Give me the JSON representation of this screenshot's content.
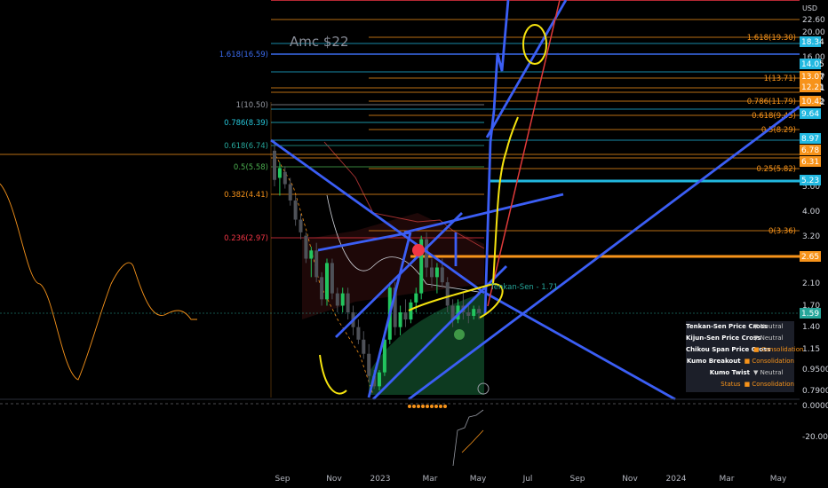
{
  "axis": {
    "currency": "USD",
    "y_ticks": [
      "22.60",
      "20.00",
      "16.00",
      "13.07",
      "12.21",
      "10.42",
      "8.97",
      "6.78",
      "6.31",
      "5.00",
      "4.00",
      "3.20",
      "2.10",
      "1.70",
      "1.40",
      "1.15",
      "0.9500",
      "0.7900"
    ],
    "x_ticks": [
      "Sep",
      "Nov",
      "2023",
      "Mar",
      "May",
      "Jul",
      "Sep",
      "Nov",
      "2024",
      "Mar",
      "May"
    ],
    "osc_ticks": [
      "0.0000",
      "-20.00"
    ]
  },
  "annotation": {
    "text": "Amc $22"
  },
  "price_tags": [
    {
      "label": "18.34",
      "color": "#22b8e0"
    },
    {
      "label": "14.05",
      "color": "#22b8e0"
    },
    {
      "label": "13.07",
      "color": "#f7931a"
    },
    {
      "label": "12.21",
      "color": "#f7931a"
    },
    {
      "label": "10.42",
      "color": "#f7931a"
    },
    {
      "label": "9.64",
      "color": "#22b8e0"
    },
    {
      "label": "8.97",
      "color": "#22b8e0"
    },
    {
      "label": "6.78",
      "color": "#f7931a"
    },
    {
      "label": "6.31",
      "color": "#f7931a"
    },
    {
      "label": "5.23",
      "color": "#22b8e0"
    },
    {
      "label": "2.65",
      "color": "#f7931a"
    },
    {
      "label": "1.59",
      "color": "#26a69a"
    }
  ],
  "fib_left": [
    {
      "label": "1.618(16.59)",
      "color": "#3b6cf0"
    },
    {
      "label": "1(10.50)",
      "color": "#9598a1"
    },
    {
      "label": "0.786(8.39)",
      "color": "#26c6da"
    },
    {
      "label": "0.618(6.74)",
      "color": "#26a69a"
    },
    {
      "label": "0.5(5.58)",
      "color": "#4caf50"
    },
    {
      "label": "0.382(4.41)",
      "color": "#f7931a"
    },
    {
      "label": "0.236(2.97)",
      "color": "#f23645"
    }
  ],
  "fib_right": [
    {
      "label": "1.618(19.30)",
      "color": "#f7931a"
    },
    {
      "label": "1(13.71)",
      "color": "#f7931a"
    },
    {
      "label": "0.786(11.79)",
      "color": "#f7931a"
    },
    {
      "label": "0.618(9.45)",
      "color": "#f7931a"
    },
    {
      "label": "0.5(8.29)",
      "color": "#f7931a"
    },
    {
      "label": "0.25(5.82)",
      "color": "#f7931a"
    },
    {
      "label": "0(3.36)",
      "color": "#f7931a"
    }
  ],
  "indicator_label": "Tenkan-Sen - 1.71",
  "status_panel": [
    {
      "label": "Tenkan-Sen Price Cross",
      "icon": "▼",
      "value": "Neutral",
      "accent": false
    },
    {
      "label": "Kijun-Sen Price Cross",
      "icon": "▼",
      "value": "Neutral",
      "accent": false
    },
    {
      "label": "Chikou Span Price Cross",
      "icon": "■",
      "value": "Consolidation",
      "accent": true
    },
    {
      "label": "Kumo Breakout",
      "icon": "■",
      "value": "Consolidation",
      "accent": true
    },
    {
      "label": "Kumo Twist",
      "icon": "▼",
      "value": "Neutral",
      "accent": false
    },
    {
      "label": "Status",
      "icon": "■",
      "value": "Consolidation",
      "accent": true
    }
  ],
  "chart_data": {
    "type": "candlestick",
    "ticker_note": "Amc $22",
    "y_scale": "log",
    "ylim": [
      0.79,
      22.6
    ],
    "x_range": [
      "Sep",
      "May"
    ],
    "candles": [
      {
        "o": 6.9,
        "h": 7.6,
        "l": 5.0,
        "c": 5.3
      },
      {
        "o": 5.4,
        "h": 6.2,
        "l": 4.6,
        "c": 5.9
      },
      {
        "o": 5.7,
        "h": 6.0,
        "l": 4.9,
        "c": 5.1
      },
      {
        "o": 5.1,
        "h": 5.4,
        "l": 4.2,
        "c": 4.4
      },
      {
        "o": 4.4,
        "h": 4.6,
        "l": 3.5,
        "c": 3.7
      },
      {
        "o": 3.7,
        "h": 3.9,
        "l": 3.1,
        "c": 3.3
      },
      {
        "o": 3.2,
        "h": 3.3,
        "l": 2.5,
        "c": 2.6
      },
      {
        "o": 2.6,
        "h": 2.9,
        "l": 2.2,
        "c": 2.8
      },
      {
        "o": 2.8,
        "h": 3.0,
        "l": 2.1,
        "c": 2.2
      },
      {
        "o": 2.2,
        "h": 2.3,
        "l": 1.7,
        "c": 1.8
      },
      {
        "o": 1.8,
        "h": 2.6,
        "l": 1.7,
        "c": 2.5
      },
      {
        "o": 2.5,
        "h": 2.6,
        "l": 1.8,
        "c": 1.9
      },
      {
        "o": 1.9,
        "h": 2.0,
        "l": 1.6,
        "c": 1.7
      },
      {
        "o": 1.7,
        "h": 2.0,
        "l": 1.6,
        "c": 1.9
      },
      {
        "o": 1.9,
        "h": 2.0,
        "l": 1.5,
        "c": 1.6
      },
      {
        "o": 1.6,
        "h": 1.7,
        "l": 1.3,
        "c": 1.4
      },
      {
        "o": 1.4,
        "h": 1.5,
        "l": 1.2,
        "c": 1.25
      },
      {
        "o": 1.25,
        "h": 1.35,
        "l": 1.05,
        "c": 1.1
      },
      {
        "o": 1.1,
        "h": 1.2,
        "l": 0.85,
        "c": 0.9
      },
      {
        "o": 0.9,
        "h": 0.95,
        "l": 0.8,
        "c": 0.82
      },
      {
        "o": 0.82,
        "h": 0.95,
        "l": 0.79,
        "c": 0.93
      },
      {
        "o": 0.93,
        "h": 1.3,
        "l": 0.9,
        "c": 1.25
      },
      {
        "o": 1.25,
        "h": 2.1,
        "l": 1.2,
        "c": 2.0
      },
      {
        "o": 2.0,
        "h": 2.1,
        "l": 1.3,
        "c": 1.4
      },
      {
        "o": 1.4,
        "h": 1.7,
        "l": 1.3,
        "c": 1.6
      },
      {
        "o": 1.6,
        "h": 1.8,
        "l": 1.4,
        "c": 1.5
      },
      {
        "o": 1.5,
        "h": 1.8,
        "l": 1.45,
        "c": 1.75
      },
      {
        "o": 1.75,
        "h": 2.0,
        "l": 1.6,
        "c": 1.9
      },
      {
        "o": 1.9,
        "h": 3.2,
        "l": 1.8,
        "c": 3.1
      },
      {
        "o": 3.1,
        "h": 3.3,
        "l": 2.2,
        "c": 2.4
      },
      {
        "o": 2.4,
        "h": 2.6,
        "l": 2.0,
        "c": 2.2
      },
      {
        "o": 2.2,
        "h": 2.5,
        "l": 1.9,
        "c": 2.4
      },
      {
        "o": 2.4,
        "h": 2.6,
        "l": 2.0,
        "c": 2.1
      },
      {
        "o": 2.1,
        "h": 2.2,
        "l": 1.6,
        "c": 1.7
      },
      {
        "o": 1.7,
        "h": 1.8,
        "l": 1.4,
        "c": 1.5
      },
      {
        "o": 1.5,
        "h": 1.8,
        "l": 1.45,
        "c": 1.7
      },
      {
        "o": 1.7,
        "h": 1.9,
        "l": 1.5,
        "c": 1.6
      },
      {
        "o": 1.6,
        "h": 1.75,
        "l": 1.45,
        "c": 1.55
      },
      {
        "o": 1.55,
        "h": 1.7,
        "l": 1.5,
        "c": 1.65
      },
      {
        "o": 1.65,
        "h": 1.7,
        "l": 1.5,
        "c": 1.59
      }
    ],
    "fib_levels_left": [
      16.59,
      10.5,
      8.39,
      6.74,
      5.58,
      4.41,
      2.97
    ],
    "fib_levels_right": [
      19.3,
      13.71,
      11.79,
      9.45,
      8.29,
      5.82,
      3.36
    ],
    "grid": false
  }
}
